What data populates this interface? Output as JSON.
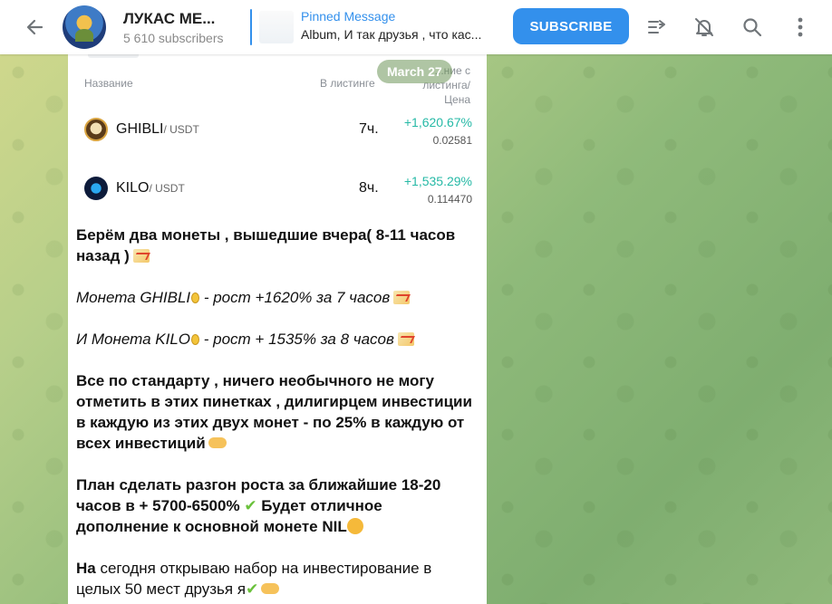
{
  "header": {
    "title": "ЛУКАС МЕ...",
    "subscribers": "5 610 subscribers",
    "pinned_title": "Pinned Message",
    "pinned_text": "Album, И так друзья , что кас...",
    "subscribe_label": "SUBSCRIBE",
    "icons": [
      "back-arrow-icon",
      "channel-avatar",
      "manage-icon",
      "mute-icon",
      "search-icon",
      "more-vertical-icon"
    ]
  },
  "date_pill": "March 27",
  "table": {
    "col_name": "Название",
    "col_listing": "В листинге",
    "col_change_1": "...ние с",
    "col_change_2": "листинга/",
    "col_change_3": "Цена",
    "rows": [
      {
        "name": "GHIBLI",
        "pair": "/ USDT",
        "time": "7ч.",
        "pct": "+1,620.67%",
        "price": "0.02581"
      },
      {
        "name": "KILO",
        "pair": "/ USDT",
        "time": "8ч.",
        "pct": "+1,535.29%",
        "price": "0.114470"
      }
    ]
  },
  "message": {
    "p1": "Берём два монеты , вышедшие вчера(  8-11 часов назад )",
    "p2_a": "Монета GHIBLI",
    "p2_b": "  - рост +1620% за 7 часов",
    "p3_a": "И Монета KILO",
    "p3_b": "  - рост  + 1535% за 8 часов",
    "p4": "Все по стандарту , ничего необычного не могу отметить в этих пинетках , дилигирцем инвестиции в каждую из этих двух монет - по 25% в каждую от всех инвестиций",
    "p5_a": "План сделать  разгон роста за ближайшие 18-20 часов в + 5700-6500%",
    "p5_b": " Будет отличное дополнение к основной монете NIL",
    "p6_a": "На",
    "p6_b": " сегодня открываю набор на инвестирование в целых 50 мест друзья я",
    "check": "✔"
  }
}
